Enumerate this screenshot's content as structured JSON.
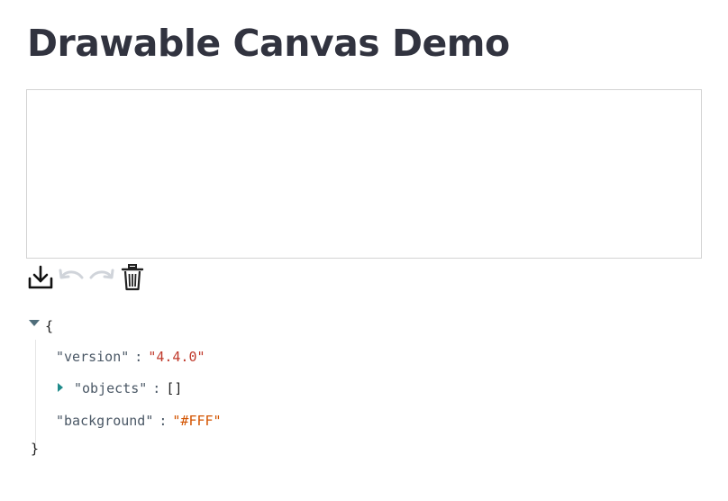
{
  "page": {
    "title": "Drawable Canvas Demo"
  },
  "toolbar": {
    "download_icon": "download-icon",
    "undo_icon": "undo-icon",
    "redo_icon": "redo-icon",
    "delete_icon": "trash-icon"
  },
  "json_view": {
    "open_brace": "{",
    "close_brace": "}",
    "entries": [
      {
        "key": "\"version\"",
        "colon": ":",
        "value": "\"4.4.0\""
      },
      {
        "key": "\"objects\"",
        "colon": ":",
        "value": "[]"
      },
      {
        "key": "\"background\"",
        "colon": ":",
        "value": "\"#FFF\""
      }
    ]
  },
  "colors": {
    "title": "#31333f",
    "canvas_border": "#d3d3d3",
    "string_value": "#c0392b",
    "toggle_arrow": "#1f8a8a"
  }
}
